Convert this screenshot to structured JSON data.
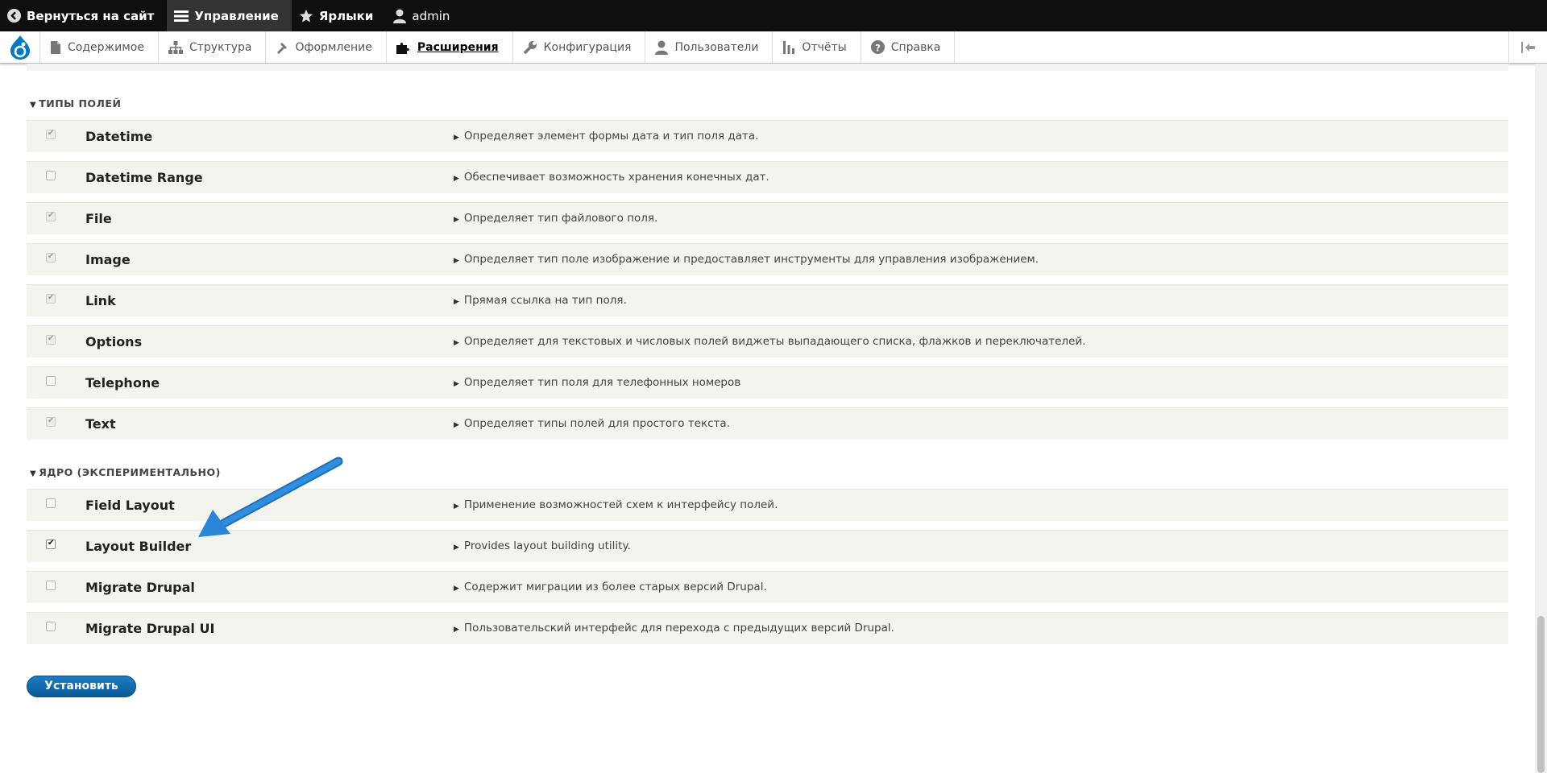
{
  "toolbar": {
    "back_label": "Вернуться на сайт",
    "manage_label": "Управление",
    "shortcuts_label": "Ярлыки",
    "user_label": "admin"
  },
  "tray": {
    "items": [
      {
        "label": "Содержимое",
        "icon": "file-icon"
      },
      {
        "label": "Структура",
        "icon": "sitemap-icon"
      },
      {
        "label": "Оформление",
        "icon": "brush-icon"
      },
      {
        "label": "Расширения",
        "icon": "puzzle-icon"
      },
      {
        "label": "Конфигурация",
        "icon": "wrench-icon"
      },
      {
        "label": "Пользователи",
        "icon": "people-icon"
      },
      {
        "label": "Отчёты",
        "icon": "bar-chart-icon"
      },
      {
        "label": "Справка",
        "icon": "help-icon"
      }
    ],
    "active_index": 3
  },
  "sections": [
    {
      "title": "ТИПЫ ПОЛЕЙ",
      "modules": [
        {
          "name": "Datetime",
          "desc": "Определяет элемент формы дата и тип поля дата.",
          "checked": true,
          "disabled": true
        },
        {
          "name": "Datetime Range",
          "desc": "Обеспечивает возможность хранения конечных дат.",
          "checked": false,
          "disabled": false
        },
        {
          "name": "File",
          "desc": "Определяет тип файлового поля.",
          "checked": true,
          "disabled": true
        },
        {
          "name": "Image",
          "desc": "Определяет тип поле изображение и предоставляет инструменты для управления изображением.",
          "checked": true,
          "disabled": true
        },
        {
          "name": "Link",
          "desc": "Прямая ссылка на тип поля.",
          "checked": true,
          "disabled": true
        },
        {
          "name": "Options",
          "desc": "Определяет для текстовых и числовых полей виджеты выпадающего списка, флажков и переключателей.",
          "checked": true,
          "disabled": true
        },
        {
          "name": "Telephone",
          "desc": "Определяет тип поля для телефонных номеров",
          "checked": false,
          "disabled": false
        },
        {
          "name": "Text",
          "desc": "Определяет типы полей для простого текста.",
          "checked": true,
          "disabled": true
        }
      ]
    },
    {
      "title": "ЯДРО (ЭКСПЕРИМЕНТАЛЬНО)",
      "modules": [
        {
          "name": "Field Layout",
          "desc": "Применение возможностей схем к интерфейсу полей.",
          "checked": false,
          "disabled": false
        },
        {
          "name": "Layout Builder",
          "desc": "Provides layout building utility.",
          "checked": true,
          "disabled": false
        },
        {
          "name": "Migrate Drupal",
          "desc": "Содержит миграции из более старых версий Drupal.",
          "checked": false,
          "disabled": false
        },
        {
          "name": "Migrate Drupal UI",
          "desc": "Пользовательский интерфейс для перехода с предыдущих версий Drupal.",
          "checked": false,
          "disabled": false
        }
      ]
    }
  ],
  "install_label": "Установить",
  "colors": {
    "accent": "#0a6fb8",
    "row_bg": "#f3f4ee",
    "arrow": "#2a86d8"
  }
}
